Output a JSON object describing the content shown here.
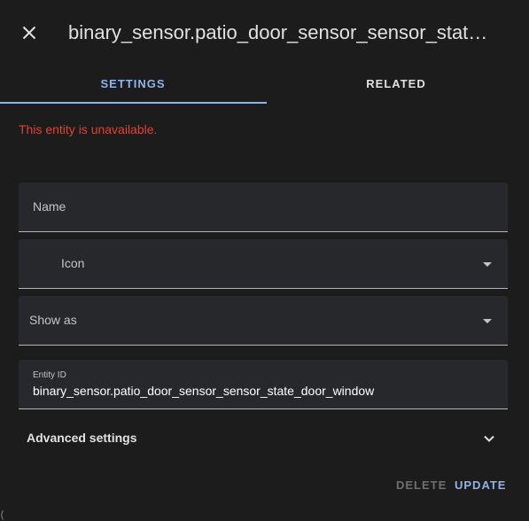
{
  "dialog": {
    "title": "binary_sensor.patio_door_sensor_sensor_state_door_window",
    "close_icon": "close-icon"
  },
  "tabs": [
    {
      "label": "SETTINGS",
      "active": true
    },
    {
      "label": "RELATED",
      "active": false
    }
  ],
  "error_message": "This entity is unavailable.",
  "form": {
    "name": {
      "label": "Name",
      "value": ""
    },
    "icon": {
      "label": "Icon",
      "value": ""
    },
    "show_as": {
      "label": "Show as",
      "value": ""
    },
    "entity_id": {
      "label": "Entity ID",
      "value": "binary_sensor.patio_door_sensor_sensor_state_door_window"
    }
  },
  "advanced": {
    "label": "Advanced settings",
    "icon": "chevron-down-icon"
  },
  "actions": {
    "delete_label": "DELETE",
    "update_label": "UPDATE"
  },
  "colors": {
    "accent": "#8fb4ea",
    "error": "#db4437",
    "background": "#1c1c1c",
    "field_background": "#26282b"
  }
}
